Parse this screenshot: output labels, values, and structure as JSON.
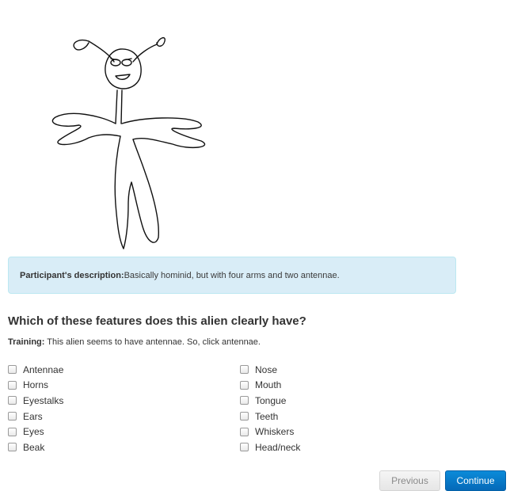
{
  "description": {
    "label": "Participant's description:",
    "text": "Basically hominid, but with four arms and two antennae."
  },
  "question": "Which of these features does this alien clearly have?",
  "training": {
    "label": "Training:",
    "text": " This alien seems to have antennae. So, click antennae."
  },
  "features_left": [
    "Antennae",
    "Horns",
    "Eyestalks",
    "Ears",
    "Eyes",
    "Beak"
  ],
  "features_right": [
    "Nose",
    "Mouth",
    "Tongue",
    "Teeth",
    "Whiskers",
    "Head/neck"
  ],
  "buttons": {
    "previous": "Previous",
    "continue": "Continue"
  },
  "colors": {
    "alert_bg": "#d9edf7",
    "primary": "#0a7fd0"
  }
}
